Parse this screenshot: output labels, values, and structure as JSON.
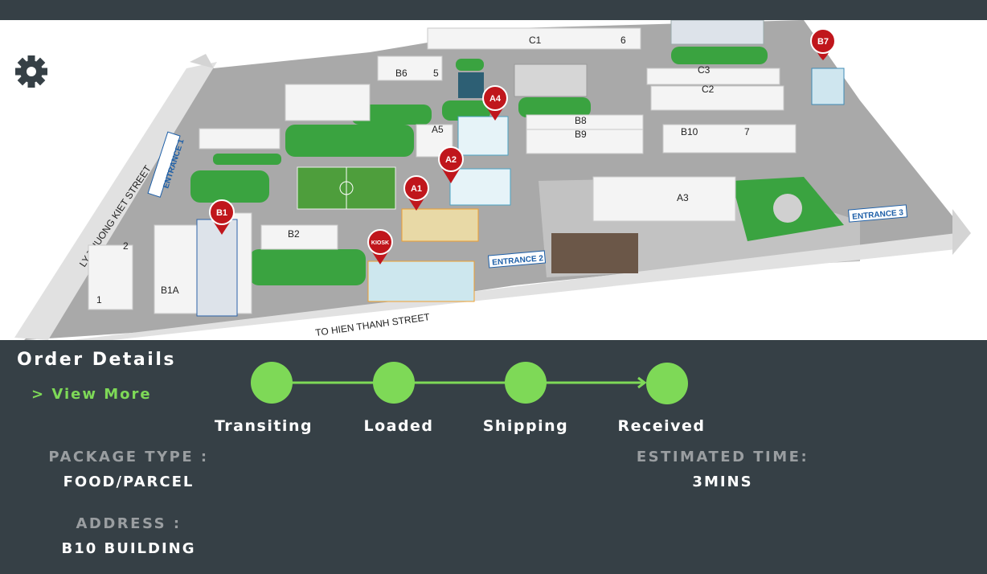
{
  "map": {
    "streets": {
      "left": "LY THUONG KIET STREET",
      "bottom": "TO HIEN THANH STREET"
    },
    "entrances": [
      "ENTRANCE 1",
      "ENTRANCE 2",
      "ENTRANCE 3"
    ],
    "buildings": {
      "c1": "C1",
      "c1_num": "6",
      "b6": "B6",
      "b6_num": "5",
      "c3": "C3",
      "c2": "C2",
      "b8": "B8",
      "b9": "B9",
      "b10": "B10",
      "b10_num": "7",
      "a5": "A5",
      "a3": "A3",
      "b2": "B2",
      "b1a": "B1A",
      "n1": "1",
      "n2": "2"
    },
    "pins": {
      "b7": "B7",
      "a4": "A4",
      "a2": "A2",
      "a1": "A1",
      "b1": "B1",
      "kiosk": "KIOSK"
    }
  },
  "settings": {
    "icon": "gear-icon"
  },
  "order": {
    "title": "Order Details",
    "view_more": "> View More",
    "steps": [
      "Transiting",
      "Loaded",
      "Shipping",
      "Received"
    ],
    "package_type_label": "PACKAGE TYPE :",
    "package_type_value": "FOOD/PARCEL",
    "estimated_time_label": "ESTIMATED TIME:",
    "estimated_time_value": "3MINS",
    "address_label": "ADDRESS :",
    "address_value": "B10 BUILDING"
  },
  "colors": {
    "panel": "#364046",
    "accent_green": "#7ed957",
    "label_gray": "#9a9ea1",
    "pin_red": "#c0161c"
  }
}
